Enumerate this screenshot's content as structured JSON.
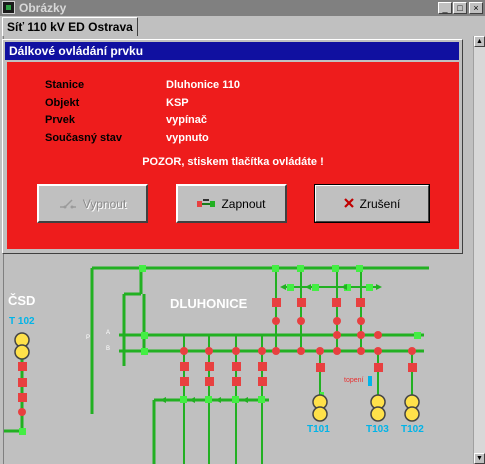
{
  "window": {
    "title": "Obrázky",
    "controls": [
      "_",
      "□",
      "×"
    ]
  },
  "tabs": [
    {
      "label": "Síť 110 kV ED Ostrava",
      "active": true
    }
  ],
  "dialog": {
    "title": "Dálkové ovládání prvku",
    "fields": [
      {
        "label": "Stanice",
        "value": "Dluhonice  110"
      },
      {
        "label": "Objekt",
        "value": "KSP"
      },
      {
        "label": "Prvek",
        "value": "vypínač"
      },
      {
        "label": "Současný stav",
        "value": "vypnuto"
      }
    ],
    "warning": "POZOR, stiskem tlačítka ovládáte !",
    "buttons": {
      "off": {
        "label": "Vypnout",
        "enabled": false
      },
      "on": {
        "label": "Zapnout",
        "enabled": true
      },
      "cancel": {
        "label": "Zrušení",
        "enabled": true,
        "focused": true
      }
    }
  },
  "diagram": {
    "station_labels": {
      "csd": "ČSD",
      "dluhonice": "DLUHONICE"
    },
    "transformers": {
      "t102_left": "T 102",
      "t101": "T101",
      "t103": "T103",
      "t102_right": "T102"
    },
    "bus_labels": {
      "a": "A",
      "b": "B",
      "p": "P"
    },
    "note": "topení",
    "colors": {
      "background": "#c0c0c0",
      "line": "#22b022",
      "breaker": "#e84040",
      "node": "#44ee44",
      "transformer": "#ffe14a",
      "label": "#00b4e8"
    }
  }
}
